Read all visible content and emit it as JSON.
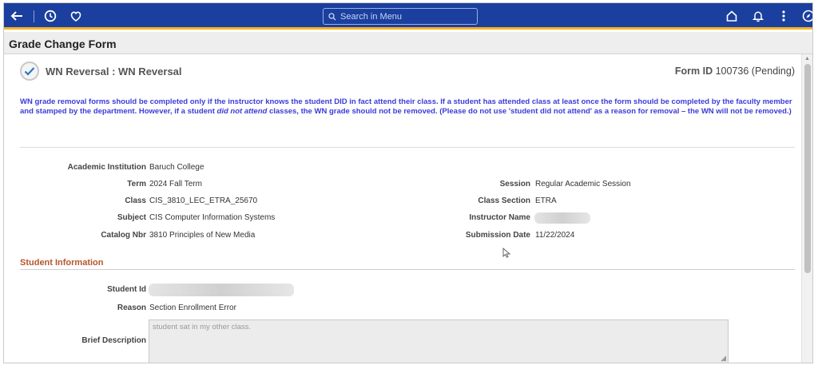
{
  "nav": {
    "back_icon": "arrow-left-icon",
    "history_icon": "clock-icon",
    "favorites_icon": "heart-icon",
    "search_placeholder": "Search in Menu",
    "home_icon": "home-icon",
    "notifications_icon": "bell-icon",
    "more_icon": "vertical-ellipsis-icon",
    "navigator_icon": "compass-icon"
  },
  "page": {
    "title": "Grade Change Form"
  },
  "form": {
    "status_icon": "checkmark-icon",
    "heading": "WN Reversal : WN Reversal",
    "form_id_label": "Form ID",
    "form_id_value": "100736 (Pending)",
    "notice_part1": "WN grade removal forms should be completed only if the instructor knows the student DID in fact attend their class. If a student has attended class at least once the form should be completed by the faculty member and stamped by the department. However, if a student ",
    "notice_italic": "did not attend",
    "notice_part2": " classes, the WN grade should not be removed. (Please do not use 'student did not attend' as a reason for removal – the WN will not be removed.)"
  },
  "details": {
    "institution_label": "Academic Institution",
    "institution_value": "Baruch College",
    "term_label": "Term",
    "term_value": "2024 Fall Term",
    "class_label": "Class",
    "class_value": "CIS_3810_LEC_ETRA_25670",
    "subject_label": "Subject",
    "subject_value": "CIS Computer Information Systems",
    "catalog_label": "Catalog Nbr",
    "catalog_value": "3810 Principles of New Media",
    "session_label": "Session",
    "session_value": "Regular Academic Session",
    "class_section_label": "Class Section",
    "class_section_value": "ETRA",
    "instructor_label": "Instructor Name",
    "submission_label": "Submission Date",
    "submission_value": "11/22/2024"
  },
  "student": {
    "section_title": "Student Information",
    "id_label": "Student Id",
    "reason_label": "Reason",
    "reason_value": "Section Enrollment Error",
    "description_label": "Brief Description",
    "description_value": "student sat in my other class."
  },
  "colors": {
    "nav_bg": "#1a3f9e",
    "nav_accent": "#f5b324",
    "notice_text": "#3b3bd9",
    "section_title": "#b6552a"
  }
}
